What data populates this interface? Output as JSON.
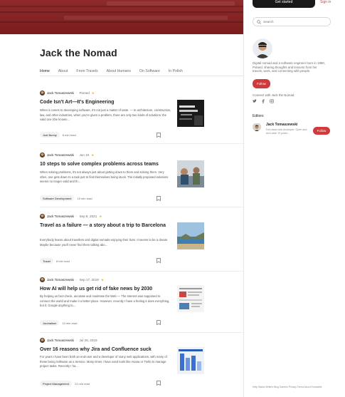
{
  "header": {
    "get_started": "Get started",
    "sign_in": "Sign in"
  },
  "publication": {
    "title": "Jack the Nomad",
    "tabs": [
      "Home",
      "About",
      "From Travels",
      "About Humans",
      "On Software",
      "In Polish"
    ]
  },
  "articles": [
    {
      "author": "Jack Tomaszewski",
      "date": "Pinned",
      "star": "★",
      "title": "Code Isn't Art—It's Engineering",
      "snippet": "When it comes to developing software, it's not just a matter of taste. — In architecture, construction, law, and other industries, when you're given a problem, there are only two kinds of solutions: the valid one (the known...",
      "tag": "Just Bunny",
      "read_time": "8 min read"
    },
    {
      "author": "Jack Tomaszewski",
      "date": "Jun 10",
      "star": "★",
      "title": "10 steps to solve complex problems across teams",
      "snippet": "When solving problems, it's not always just about getting down to them and solving them. Very often, one gets down to a task just to find themselves being stuck. The initially proposed solutions seems no longer valid and th...",
      "tag": "Software Development",
      "read_time": "10 min read"
    },
    {
      "author": "Jack Tomaszewski",
      "date": "Sep 8, 2021",
      "star": "★",
      "title": "Travel as a failure — a story about a trip to Barcelona",
      "snippet": "Everybody learns about travellers and digital nomads enjoying their lives. It seems to be a dream. Maybe because you'll never find them talking abo...",
      "tag": "Travel",
      "read_time": "8 min read"
    },
    {
      "author": "Jack Tomaszewski",
      "date": "Sep 17, 2019",
      "star": "★",
      "title": "How AI will help us get rid of fake news by 2030",
      "snippet": "By helping us fact-check, annotate and moderate the Web — The Internet was supposed to connect the world and make it a better place. However, recently I have a feeling it does everything, but it. Google anything to...",
      "tag": "Journalism",
      "read_time": "10 min read"
    },
    {
      "author": "Jack Tomaszewski",
      "date": "Jul 26, 2019",
      "star": "",
      "title": "Over 16 reasons why Jira and Confluence suck",
      "snippet": "For years I have been both an end-user and a developer of many web applications, with many of these being Software as a Service. Many times I have used tools like Asana or Trello to manage project tasks. Recently I ha...",
      "tag": "Project Management",
      "read_time": "13 min read"
    }
  ],
  "sidebar": {
    "search_placeholder": "Search",
    "bio": "Digital nomad and a software engineer born in 1990, Poland, sharing thoughts and lessons from his travels, work, and connecting with people.",
    "follow": "Follow",
    "connect": "Connect with Jack the Nomad",
    "editors_heading": "Editors",
    "editor": {
      "name": "Jack Tomaszewski",
      "bio": "Full-stack web developer. Open and tech-wise 19 years...",
      "follow": "Follow"
    },
    "footer": "Help Status Writers Blog Careers Privacy Terms About Knowable"
  },
  "colors": {
    "banner": "#7a1d1d",
    "accent": "#d13a3a",
    "dark": "#191919"
  }
}
